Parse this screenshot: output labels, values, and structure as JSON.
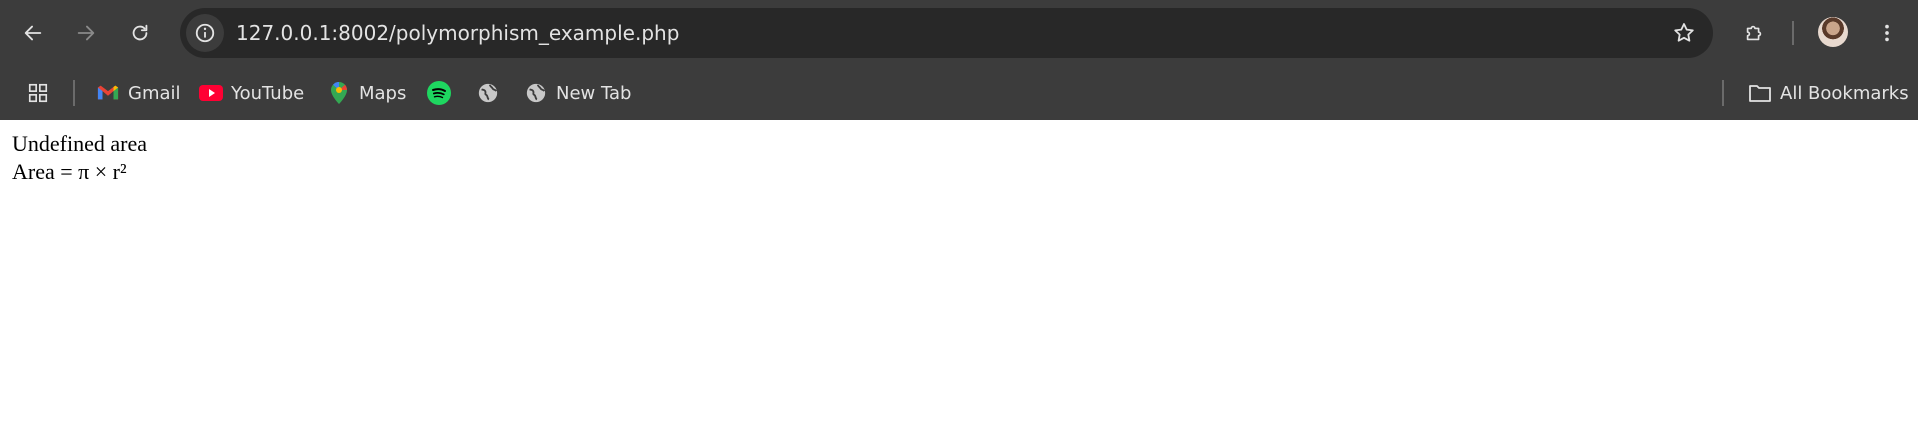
{
  "browser": {
    "url": "127.0.0.1:8002/polymorphism_example.php",
    "icons": {
      "back": "back-arrow-icon",
      "forward": "forward-arrow-icon",
      "reload": "reload-icon",
      "site_info": "info-icon",
      "bookmark_star": "star-icon",
      "extensions": "puzzle-piece-icon",
      "profile": "avatar",
      "menu": "three-dots-menu-icon"
    },
    "colors": {
      "chrome_bg": "#3c3c3c",
      "omnibox_bg": "#282828",
      "text": "#e3e3e3"
    }
  },
  "bookmarks": {
    "items": [
      {
        "label": "Gmail",
        "icon": "gmail-icon"
      },
      {
        "label": "YouTube",
        "icon": "youtube-icon"
      },
      {
        "label": "Maps",
        "icon": "maps-icon"
      },
      {
        "label": "",
        "icon": "spotify-icon"
      },
      {
        "label": "",
        "icon": "globe-icon"
      },
      {
        "label": "New Tab",
        "icon": "globe-icon"
      }
    ],
    "all_bookmarks_label": "All Bookmarks"
  },
  "page": {
    "line1": "Undefined area",
    "line2": "Area = π × r²"
  }
}
